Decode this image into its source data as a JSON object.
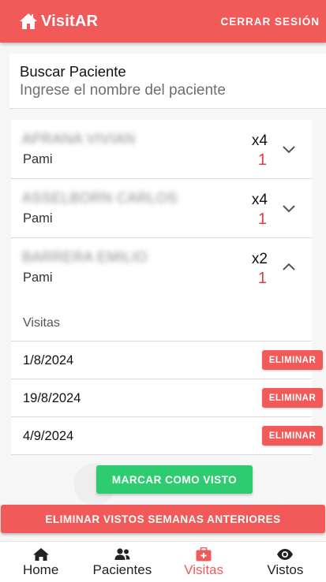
{
  "app": {
    "title": "VisitAR",
    "logout_label": "CERRAR SESIÓN"
  },
  "search": {
    "label": "Buscar Paciente",
    "placeholder": "Ingrese el nombre del paciente"
  },
  "patients": [
    {
      "name": "APRANA VIVIAN",
      "plan": "Pami",
      "count": "x4",
      "pending": "1",
      "expanded": false
    },
    {
      "name": "ASSELBORN CARLOS",
      "plan": "Pami",
      "count": "x4",
      "pending": "1",
      "expanded": false
    },
    {
      "name": "BARRERA EMILIO",
      "plan": "Pami",
      "count": "x2",
      "pending": "1",
      "expanded": true
    }
  ],
  "visits": {
    "header": "Visitas",
    "rows": [
      {
        "date": "1/8/2024",
        "action": "ELIMINAR"
      },
      {
        "date": "19/8/2024",
        "action": "ELIMINAR"
      },
      {
        "date": "4/9/2024",
        "action": "ELIMINAR"
      }
    ]
  },
  "actions": {
    "mark_seen": "MARCAR COMO VISTO",
    "clear_old": "ELIMINAR VISTOS SEMANAS ANTERIORES"
  },
  "nav": [
    {
      "label": "Home",
      "icon": "home-icon",
      "active": false
    },
    {
      "label": "Pacientes",
      "icon": "users-icon",
      "active": false
    },
    {
      "label": "Visitas",
      "icon": "medkit-icon",
      "active": true
    },
    {
      "label": "Vistos",
      "icon": "eye-icon",
      "active": false
    }
  ],
  "colors": {
    "brand": "#f25a5a",
    "success": "#2ecc71",
    "pending": "#e23c3c"
  }
}
